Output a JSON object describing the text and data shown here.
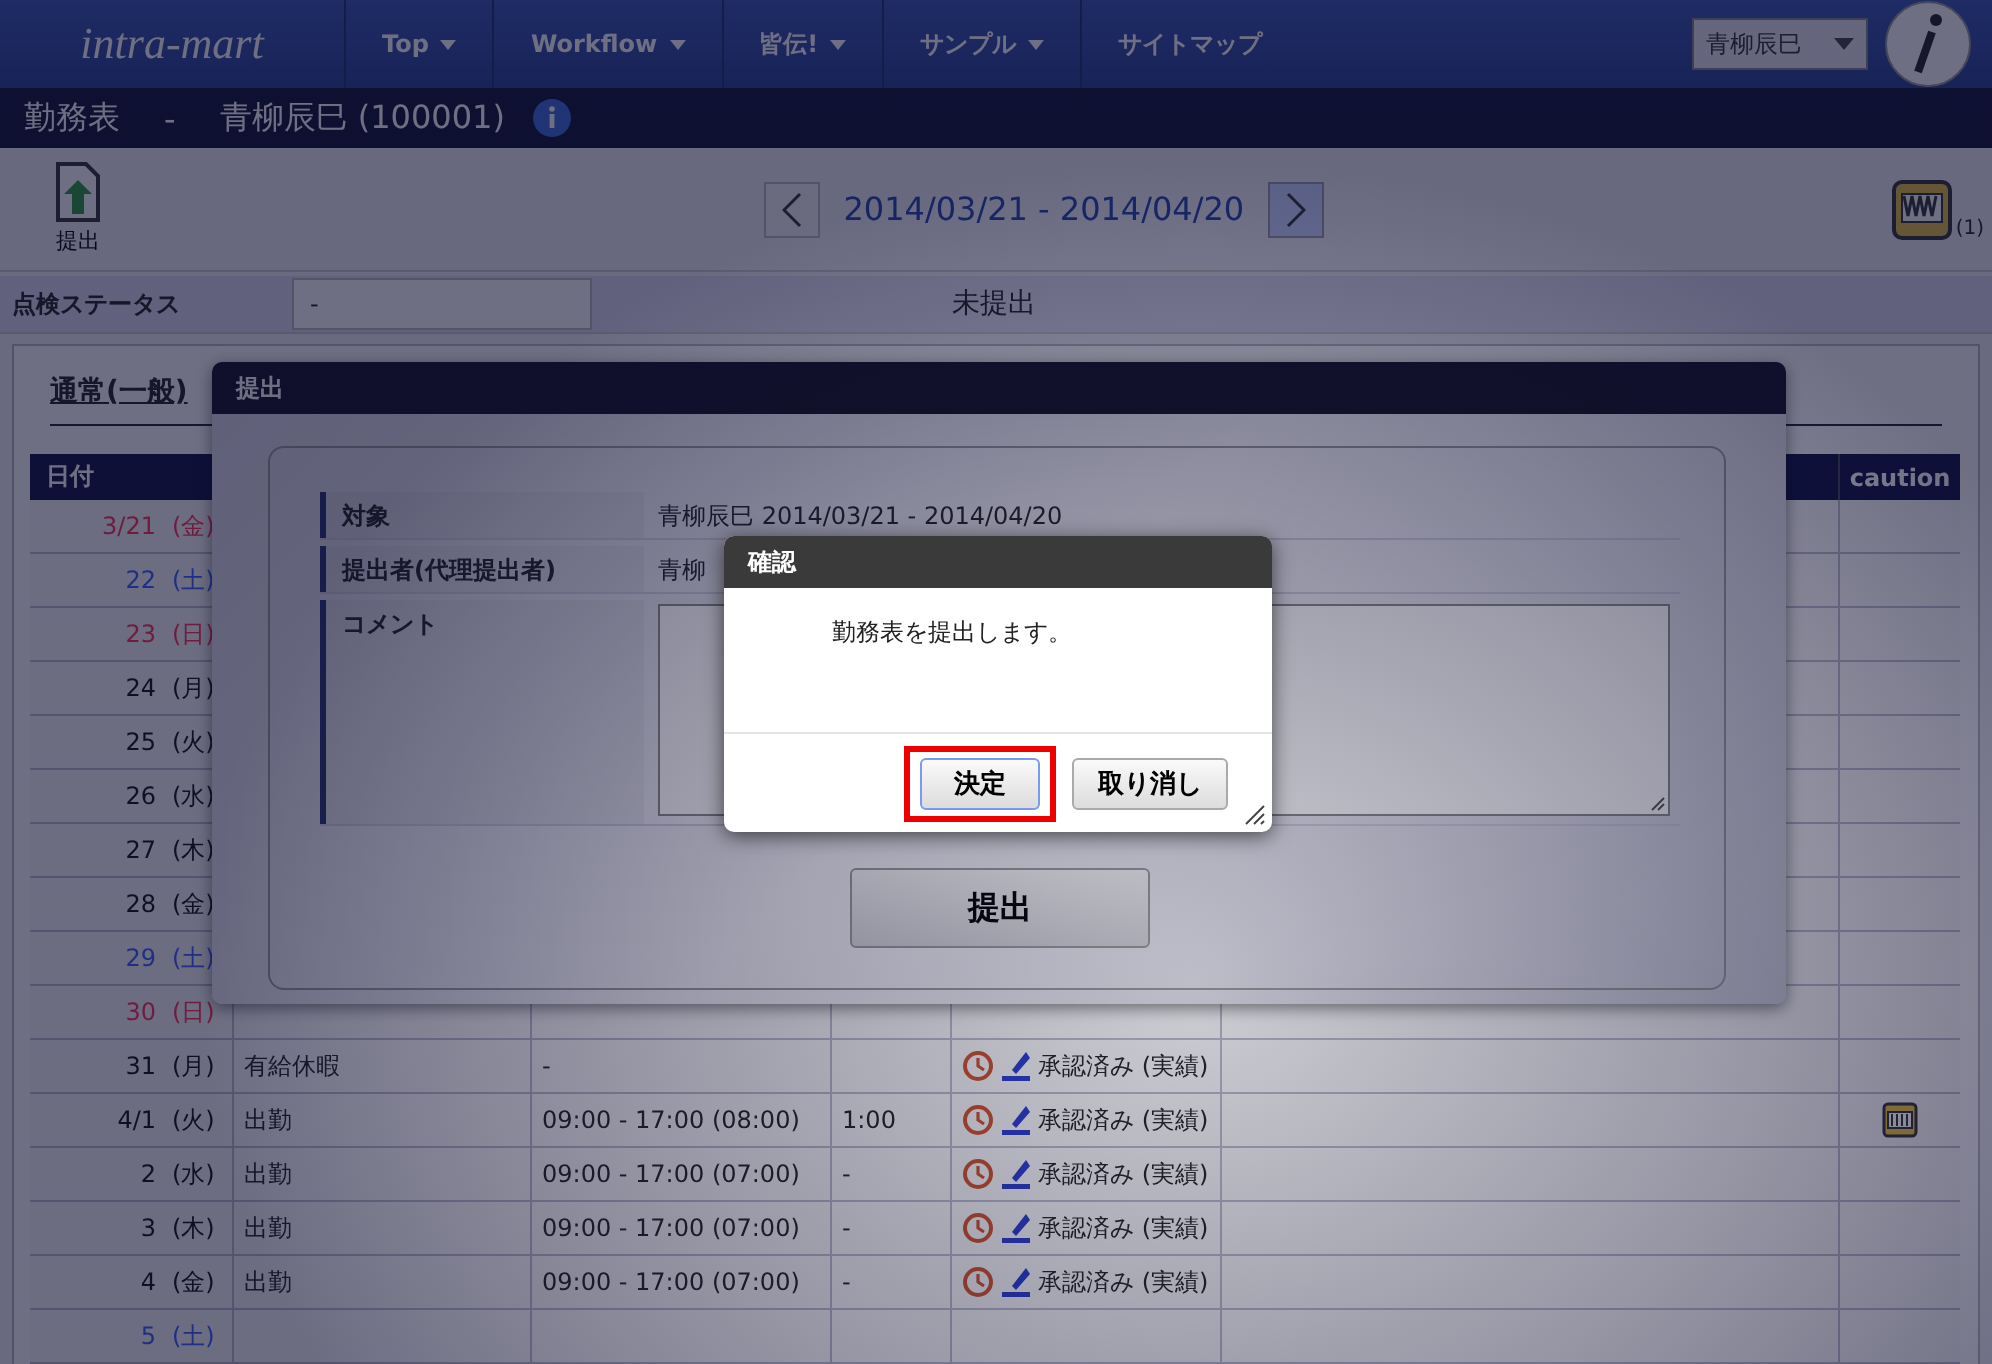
{
  "nav": {
    "logo": "intra-mart",
    "menus": [
      {
        "label": "Top",
        "dropdown": true
      },
      {
        "label": "Workflow",
        "dropdown": true
      },
      {
        "label": "皆伝!",
        "dropdown": true
      },
      {
        "label": "サンプル",
        "dropdown": true
      },
      {
        "label": "サイトマップ",
        "dropdown": false
      }
    ],
    "user": "青柳辰巳"
  },
  "title_bar": {
    "title": "勤務表",
    "separator": "-",
    "user": "青柳辰巳 (100001)"
  },
  "toolbar": {
    "submit_label": "提出",
    "period": "2014/03/21 - 2014/04/20",
    "badge": "(1)"
  },
  "inspection": {
    "label": "点検ステータス",
    "value": "-",
    "status": "未提出"
  },
  "section": {
    "title": "通常(一般)",
    "columns": [
      {
        "label": "日付"
      },
      {
        "label": "caution"
      }
    ],
    "rows": [
      {
        "date": "3/21",
        "weekday": "(金)",
        "kind": "holiday"
      },
      {
        "date": "22",
        "weekday": "(土)",
        "kind": "saturday"
      },
      {
        "date": "23",
        "weekday": "(日)",
        "kind": "holiday"
      },
      {
        "date": "24",
        "weekday": "(月)",
        "kind": "weekday"
      },
      {
        "date": "25",
        "weekday": "(火)",
        "kind": "weekday"
      },
      {
        "date": "26",
        "weekday": "(水)",
        "kind": "weekday"
      },
      {
        "date": "27",
        "weekday": "(木)",
        "kind": "weekday"
      },
      {
        "date": "28",
        "weekday": "(金)",
        "kind": "weekday"
      },
      {
        "date": "29",
        "weekday": "(土)",
        "kind": "saturday"
      },
      {
        "date": "30",
        "weekday": "(日)",
        "kind": "holiday"
      },
      {
        "date": "31",
        "weekday": "(月)",
        "kind": "weekday",
        "column_2": "有給休暇",
        "column_3": "-",
        "status": "承認済み (実績)",
        "caution": false
      },
      {
        "date": "4/1",
        "weekday": "(火)",
        "kind": "weekday",
        "column_2": "出勤",
        "column_3": "09:00 - 17:00 (08:00)",
        "column_4": "1:00",
        "status": "承認済み (実績)",
        "caution": true
      },
      {
        "date": "2",
        "weekday": "(水)",
        "kind": "weekday",
        "column_2": "出勤",
        "column_3": "09:00 - 17:00 (07:00)",
        "column_4": "-",
        "status": "承認済み (実績)",
        "caution": false
      },
      {
        "date": "3",
        "weekday": "(木)",
        "kind": "weekday",
        "column_2": "出勤",
        "column_3": "09:00 - 17:00 (07:00)",
        "column_4": "-",
        "status": "承認済み (実績)",
        "caution": false
      },
      {
        "date": "4",
        "weekday": "(金)",
        "kind": "weekday",
        "column_2": "出勤",
        "column_3": "09:00 - 17:00 (07:00)",
        "column_4": "-",
        "status": "承認済み (実績)",
        "caution": false
      },
      {
        "date": "5",
        "weekday": "(土)",
        "kind": "saturday"
      }
    ]
  },
  "submit_dialog": {
    "title": "提出",
    "fields": [
      {
        "label": "対象",
        "value": "青柳辰巳 2014/03/21 - 2014/04/20",
        "kind": "text"
      },
      {
        "label": "提出者(代理提出者)",
        "value": "青柳",
        "kind": "text"
      },
      {
        "label": "コメント",
        "kind": "textarea"
      }
    ],
    "button": "提出"
  },
  "confirm_dialog": {
    "title": "確認",
    "message": "勤務表を提出します。",
    "buttons": [
      {
        "label": "決定",
        "highlighted": true
      },
      {
        "label": "取り消し",
        "highlighted": false
      }
    ]
  }
}
